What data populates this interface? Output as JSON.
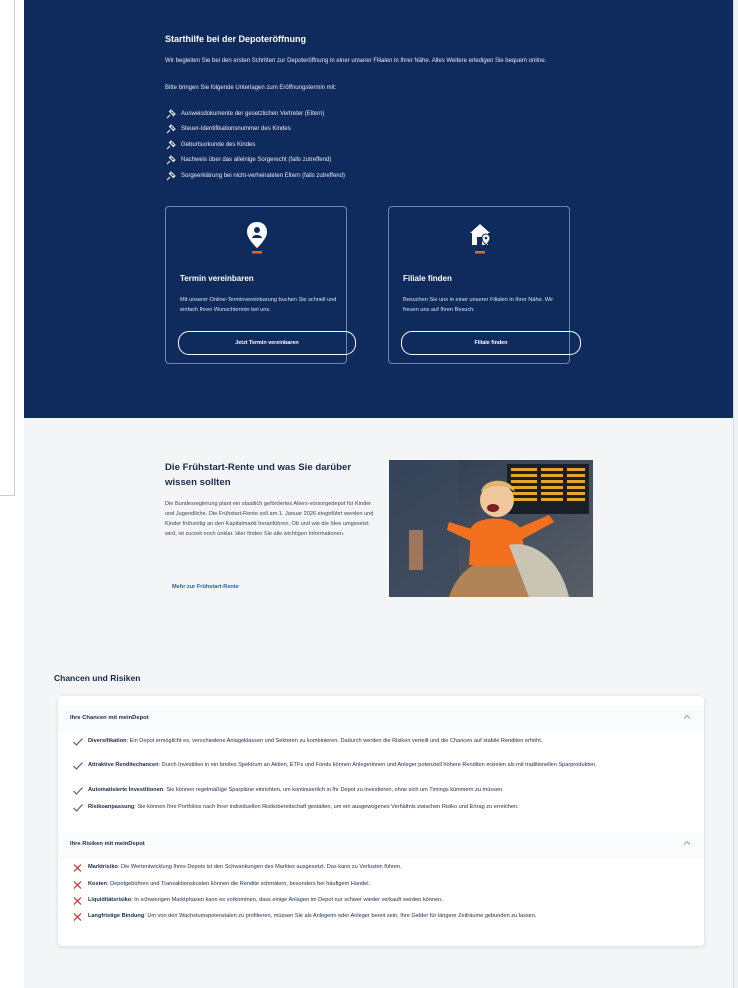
{
  "hero": {
    "title": "Starthilfe bei der Depoteröffnung",
    "intro": "Wir begleiten Sie bei den ersten Schritten zur Depoteröffnung in einer unserer Filialen in Ihrer Nähe. Alles Weitere erledigen Sie bequem online.",
    "bring": "Bitte bringen Sie folgende Unterlagen zum Eröffnungstermin mit:",
    "documents": [
      "Ausweisdokumente der gesetzlichen Vertreter (Eltern)",
      "Steuer-Identifikationsnummer des Kindes",
      "Geburtsurkunde des Kindes",
      "Nachweis über das alleinige Sorgerecht (falls zutreffend)",
      "Sorgeerklärung bei nicht-verheirateten Eltern (falls zutreffend)"
    ],
    "cards": [
      {
        "title": "Termin vereinbaren",
        "text": "Mit unserer Online-Terminvereinbarung buchen Sie schnell und einfach Ihren Wunschtermin bei uns.",
        "button": "Jetzt Termin vereinbaren"
      },
      {
        "title": "Filiale finden",
        "text": "Besuchen Sie uns in einer unserer Filialen in Ihrer Nähe. Wir freuen uns auf Ihren Besuch.",
        "button": "Filiale finden"
      }
    ]
  },
  "fruehstart": {
    "title": "Die Frühstart-Rente und was Sie darüber wissen sollten",
    "text": "Die Bundesregierung plant ein staatlich gefördertes Alters-vorsorgedepot für Kinder und Jugendliche. Die Frühstart-Rente soll am 1. Januar 2026 eingeführt werden und Kinder frühzeitig an den Kapitalmarkt heranführen. Ob und wie die Idee umgesetzt wird, ist zurzeit noch unklar. Hier finden Sie alle wichtigen Informationen.",
    "link": "Mehr zur Frühstart-Rente"
  },
  "chancen_risiken": {
    "title": "Chancen und Risiken",
    "chancen_title": "Ihre Chancen mit meinDepot",
    "chancen": [
      {
        "label": "Diversifikation",
        "text": ": Ein Depot ermöglicht es, verschiedene Anlageklassen und Sektoren zu kombinieren. Dadurch werden die Risiken verteilt und die Chancen auf stabile Renditen erhöht."
      },
      {
        "label": "Attraktive Renditechancen",
        "text": ": Durch Investition in ein breites Spektrum an Aktien, ETFs und Fonds können Anlegerinnen und Anleger potenziell höhere Renditen erzielen als mit traditionellen Sparprodukten."
      },
      {
        "label": "Automatisierte Investitionen",
        "text": ": Sie können regelmäßige Sparpläne einrichten, um kontinuierlich in Ihr Depot zu investieren, ohne sich um Timings kümmern zu müssen."
      },
      {
        "label": "Risikoanpassung",
        "text": ": Sie können Ihre Portfolios nach Ihrer individuellen Risikobereitschaft gestalten, um ein ausgewogenes Verhältnis zwischen Risiko und Ertrag zu erreichen."
      }
    ],
    "risiken_title": "Ihre Risiken mit meinDepot",
    "risiken": [
      {
        "label": "Marktrisiko",
        "text": ": Die Wertentwicklung Ihres Depots ist den Schwankungen des Marktes ausgesetzt. Das kann zu Verlusten führen."
      },
      {
        "label": "Kosten",
        "text": ": Depotgebühren und Transaktionskosten können die Rendite schmälern, besonders bei häufigem Handel."
      },
      {
        "label": "Liquiditätsrisiko",
        "text": ": In schwierigen Marktphasen kann es vorkommen, dass einige Anlagen im Depot nur schwer wieder verkauft werden können."
      },
      {
        "label": "Langfristige Bindung",
        "text": ": Um von den Wachstumspotenzialen zu profitieren, müssen Sie als Anlegerin oder Anleger bereit sein, Ihre Gelder für längere Zeiträume gebunden zu lassen."
      }
    ]
  },
  "colors": {
    "hero_bg": "#0f2a5c",
    "accent_orange": "#e8641e",
    "check_green": "#4c5a6e",
    "risk_red": "#d9262a",
    "link_blue": "#2c5aa8"
  }
}
